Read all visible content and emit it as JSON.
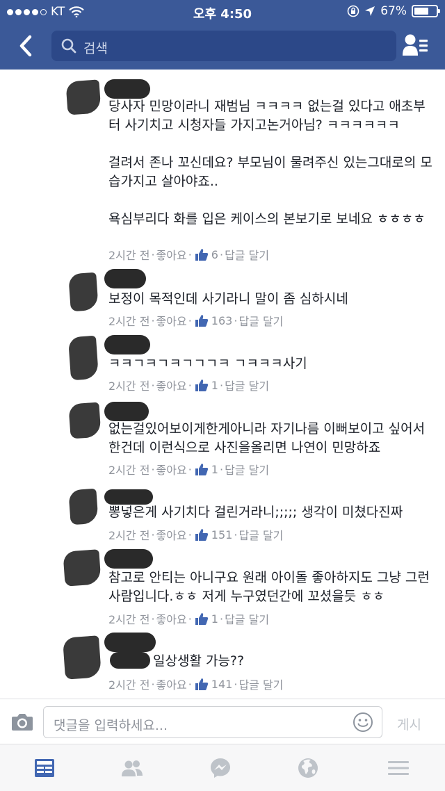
{
  "status_bar": {
    "carrier": "KT",
    "time": "오후 4:50",
    "battery": "67%",
    "battery_level": 0.67
  },
  "search": {
    "placeholder": "검색"
  },
  "comments": [
    {
      "text": "당사자 민망이라니 재범님 ㅋㅋㅋㅋ 없는걸 있다고 애초부터 사기치고 시청자들 가지고논거아님? ㅋㅋㅋㅋㅋㅋ\n\n걸려서 존나 꼬신데요? 부모님이 물려주신  있는그대로의 모습가지고 살아야죠..\n\n욕심부리다 화를 입은 케이스의 본보기로 보네요 ㅎㅎㅎㅎ",
      "time": "2시간 전",
      "like": "좋아요",
      "count": "6",
      "reply": "답글 달기"
    },
    {
      "text": "보정이 목적인데 사기라니 말이 좀 심하시네",
      "time": "2시간 전",
      "like": "좋아요",
      "count": "163",
      "reply": "답글 달기"
    },
    {
      "text": "ㅋㅋㄱㅋㄱㅋㄱㄱㄱㅋ ㄱㅋㅋㅋ사기",
      "time": "2시간 전",
      "like": "좋아요",
      "count": "1",
      "reply": "답글 달기"
    },
    {
      "text": "없는걸있어보이게한게아니라 자기나름 이뻐보이고 싶어서 한건데 이런식으로 사진을올리면 나연이 민망하죠",
      "time": "2시간 전",
      "like": "좋아요",
      "count": "1",
      "reply": "답글 달기"
    },
    {
      "text": "뽕넣은게 사기치다 걸린거라니;;;;; 생각이 미쳤다진짜",
      "time": "2시간 전",
      "like": "좋아요",
      "count": "151",
      "reply": "답글 달기"
    },
    {
      "text": "참고로 안티는 아니구요 원래 아이돌 좋아하지도 그냥 그런 사람입니다.ㅎㅎ 저게 누구였던간에 꼬셨을듯 ㅎㅎ",
      "time": "2시간 전",
      "like": "좋아요",
      "count": "1",
      "reply": "답글 달기"
    },
    {
      "text": "일상생활 가능??",
      "time": "2시간 전",
      "like": "좋아요",
      "count": "141",
      "reply": "답글 달기"
    }
  ],
  "composer": {
    "placeholder": "댓글을 입력하세요...",
    "post_label": "게시"
  },
  "tabs": [
    "news-feed-icon",
    "friends-icon",
    "messenger-icon",
    "notifications-globe-icon",
    "menu-icon"
  ],
  "colors": {
    "brand": "#3b5998",
    "link_blue": "#4267b2",
    "meta_gray": "#90949c",
    "tab_active": "#4267b2",
    "tab_inactive": "#bec3c9"
  }
}
